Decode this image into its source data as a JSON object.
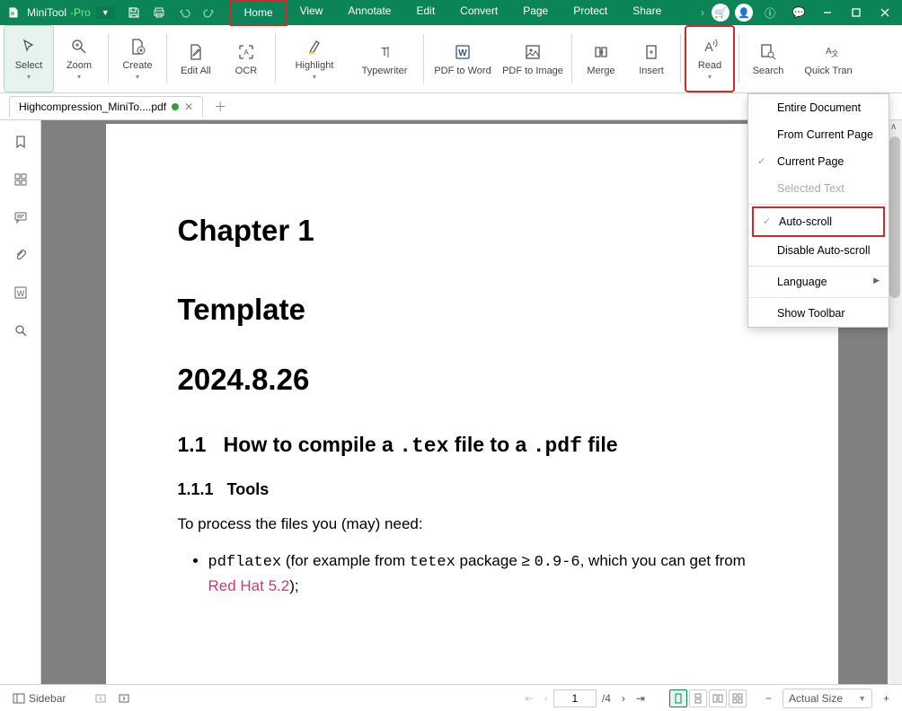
{
  "app": {
    "name": "MiniTool",
    "suffix": "-Pro"
  },
  "menus": [
    "Home",
    "View",
    "Annotate",
    "Edit",
    "Convert",
    "Page",
    "Protect",
    "Share"
  ],
  "active_menu": "Home",
  "ribbon": [
    {
      "label": "Select",
      "wide": false,
      "arrow": true,
      "sel": true
    },
    {
      "label": "Zoom",
      "wide": false,
      "arrow": true
    },
    {
      "label": "Create",
      "wide": false,
      "arrow": true
    },
    {
      "label": "Edit All",
      "wide": false
    },
    {
      "label": "OCR",
      "wide": false
    },
    {
      "label": "Highlight",
      "wide": true,
      "arrow": true
    },
    {
      "label": "Typewriter",
      "wide": true
    },
    {
      "label": "PDF to Word",
      "wide": true
    },
    {
      "label": "PDF to Image",
      "wide": true
    },
    {
      "label": "Merge",
      "wide": false
    },
    {
      "label": "Insert",
      "wide": false
    },
    {
      "label": "Read",
      "wide": false,
      "arrow": true,
      "red": true
    },
    {
      "label": "Search",
      "wide": false
    },
    {
      "label": "Quick Tran",
      "wide": true
    }
  ],
  "tab": {
    "name": "Highcompression_MiniTo....pdf"
  },
  "read_menu": [
    {
      "label": "Entire Document"
    },
    {
      "label": "From Current Page"
    },
    {
      "label": "Current Page",
      "check": true
    },
    {
      "label": "Selected Text",
      "disabled": true
    },
    {
      "sep": true
    },
    {
      "label": "Auto-scroll",
      "check": true,
      "highlighted": true
    },
    {
      "label": "Disable Auto-scroll"
    },
    {
      "sep": true
    },
    {
      "label": "Language",
      "sub": true
    },
    {
      "sep": true
    },
    {
      "label": "Show Toolbar"
    }
  ],
  "document": {
    "chapter": "Chapter 1",
    "title": "Template",
    "date": "2024.8.26",
    "sec11_num": "1.1",
    "sec11_title": "How to compile a ",
    "sec11_tt1": ".tex",
    "sec11_mid": " file to a ",
    "sec11_tt2": ".pdf",
    "sec11_end": " file",
    "sec111_num": "1.1.1",
    "sec111_title": "Tools",
    "body1": "To process the files you (may) need:",
    "li1_tt": "pdflatex",
    "li1_a": " (for example from ",
    "li1_tt2": "tetex",
    "li1_b": " package ≥ ",
    "li1_tt3": "0.9-6",
    "li1_c": ", which you can get from ",
    "li1_link": "Red Hat 5.2",
    "li1_d": ");"
  },
  "status": {
    "sidebar_label": "Sidebar",
    "page_current": "1",
    "page_total": "/4",
    "zoom": "Actual Size"
  }
}
